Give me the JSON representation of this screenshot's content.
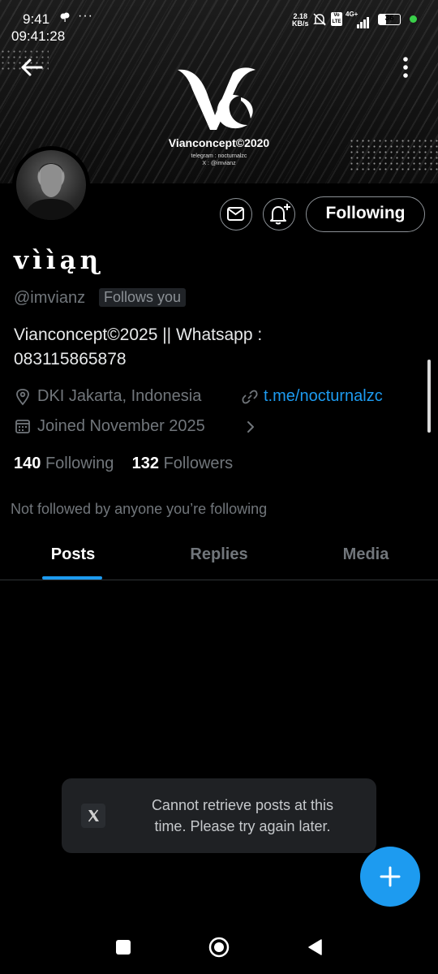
{
  "status_bar": {
    "time": "9:41",
    "clock_overlay": "09:41:28",
    "notification_dots": "···",
    "net_speed_value": "2.18",
    "net_speed_unit": "KB/s",
    "volte_label": "Vo LTE",
    "network_type": "4G+",
    "battery_level": "36",
    "battery_fraction": 0.36
  },
  "banner": {
    "brand_title": "Vianconcept©2020",
    "brand_sub_line1": "telegram : nocturnalzc",
    "brand_sub_line2": "X : @imvianz"
  },
  "profile": {
    "display_name": "vììąɳ",
    "handle": "@imvianz",
    "follows_you": "Follows you",
    "bio_line1": "Vianconcept©2025  || Whatsapp :",
    "bio_line2": "083115865878",
    "location": "DKI Jakarta, Indonesia",
    "link": "t.me/nocturnalzc",
    "joined": "Joined November 2025",
    "following_count": "140",
    "following_label": "Following",
    "followers_count": "132",
    "followers_label": "Followers",
    "not_followed_text": "Not followed by anyone you’re following"
  },
  "actions": {
    "follow_button": "Following"
  },
  "tabs": [
    {
      "label": "Posts",
      "active": true
    },
    {
      "label": "Replies",
      "active": false
    },
    {
      "label": "Media",
      "active": false
    }
  ],
  "toast": {
    "line1": "Cannot retrieve posts at this",
    "line2": "time. Please try again later."
  },
  "fab": {
    "label": "+"
  },
  "colors": {
    "accent": "#1d9bf0",
    "background": "#000000",
    "muted_text": "#71767b"
  }
}
